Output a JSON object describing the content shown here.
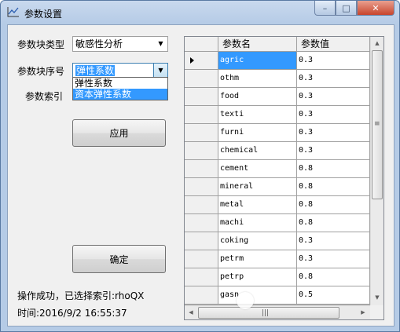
{
  "window": {
    "title": "参数设置",
    "app_icon": "chart-line-icon",
    "controls": {
      "minimize": "–",
      "maximize": "□",
      "close": "✕"
    }
  },
  "form": {
    "block_type_label": "参数块类型",
    "block_type_value": "敏感性分析",
    "block_index_label": "参数块序号",
    "block_index_value": "弹性系数",
    "dropdown_options": [
      "弹性系数",
      "资本弹性系数"
    ],
    "param_index_label": "参数索引",
    "apply_button": "应用",
    "confirm_button": "确定"
  },
  "status": {
    "message": "操作成功，已选择索引:rhoQX",
    "time": "时间:2016/9/2 16:55:37"
  },
  "grid": {
    "columns": [
      "参数名",
      "参数值"
    ],
    "rows": [
      {
        "name": "agric",
        "value": "0.3"
      },
      {
        "name": "othm",
        "value": "0.3"
      },
      {
        "name": "food",
        "value": "0.3"
      },
      {
        "name": "texti",
        "value": "0.3"
      },
      {
        "name": "furni",
        "value": "0.3"
      },
      {
        "name": "chemical",
        "value": "0.3"
      },
      {
        "name": "cement",
        "value": "0.8"
      },
      {
        "name": "mineral",
        "value": "0.8"
      },
      {
        "name": "metal",
        "value": "0.8"
      },
      {
        "name": "machi",
        "value": "0.8"
      },
      {
        "name": "coking",
        "value": "0.3"
      },
      {
        "name": "petrm",
        "value": "0.3"
      },
      {
        "name": "petrp",
        "value": "0.8"
      },
      {
        "name": "gasn",
        "value": "0.5"
      }
    ],
    "selected_row": 0,
    "icons": {
      "scroll_up": "▲",
      "scroll_down": "▼",
      "scroll_left": "◀",
      "scroll_right": "▶",
      "grip_v": "≡",
      "grip_h": "|||"
    }
  },
  "colors": {
    "selection": "#3399ff",
    "title_gradient": "#b5cbe6",
    "close_button": "#c8452d"
  }
}
